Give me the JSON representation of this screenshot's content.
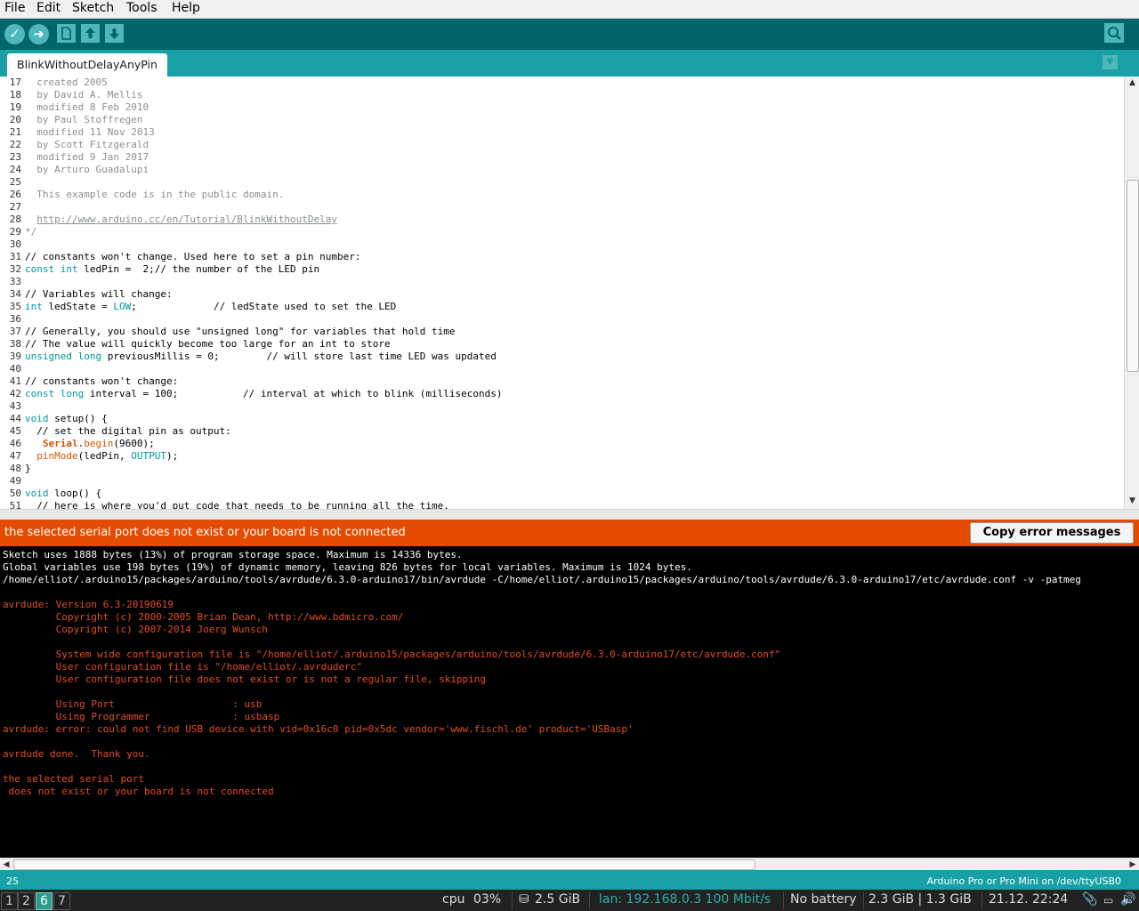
{
  "menubar": {
    "items": [
      "File",
      "Edit",
      "Sketch",
      "Tools",
      "Help"
    ]
  },
  "toolbar": {
    "verify_icon": "check-icon",
    "upload_icon": "arrow-right-icon",
    "new_icon": "new-document-icon",
    "open_icon": "arrow-up-icon",
    "save_icon": "arrow-down-icon",
    "serial_monitor_icon": "magnifier-icon"
  },
  "tab": {
    "label": "BlinkWithoutDelayAnyPin"
  },
  "editor": {
    "lines": [
      {
        "n": "17",
        "t": "  created 2005"
      },
      {
        "n": "18",
        "t": "  by David A. Mellis"
      },
      {
        "n": "19",
        "t": "  modified 8 Feb 2010"
      },
      {
        "n": "20",
        "t": "  by Paul Stoffregen"
      },
      {
        "n": "21",
        "t": "  modified 11 Nov 2013"
      },
      {
        "n": "22",
        "t": "  by Scott Fitzgerald"
      },
      {
        "n": "23",
        "t": "  modified 9 Jan 2017"
      },
      {
        "n": "24",
        "t": "  by Arturo Guadalupi"
      },
      {
        "n": "25",
        "t": ""
      },
      {
        "n": "26",
        "t": "  This example code is in the public domain."
      },
      {
        "n": "27",
        "t": ""
      },
      {
        "n": "28",
        "t": "  http://www.arduino.cc/en/Tutorial/BlinkWithoutDelay"
      },
      {
        "n": "29",
        "t": "*/"
      },
      {
        "n": "30",
        "t": ""
      },
      {
        "n": "31",
        "t": "// constants won't change. Used here to set a pin number:"
      },
      {
        "n": "32",
        "t": "const int ledPin =  2;// the number of the LED pin"
      },
      {
        "n": "33",
        "t": ""
      },
      {
        "n": "34",
        "t": "// Variables will change:"
      },
      {
        "n": "35",
        "t": "int ledState = LOW;             // ledState used to set the LED"
      },
      {
        "n": "36",
        "t": ""
      },
      {
        "n": "37",
        "t": "// Generally, you should use \"unsigned long\" for variables that hold time"
      },
      {
        "n": "38",
        "t": "// The value will quickly become too large for an int to store"
      },
      {
        "n": "39",
        "t": "unsigned long previousMillis = 0;        // will store last time LED was updated"
      },
      {
        "n": "40",
        "t": ""
      },
      {
        "n": "41",
        "t": "// constants won't change:"
      },
      {
        "n": "42",
        "t": "const long interval = 100;           // interval at which to blink (milliseconds)"
      },
      {
        "n": "43",
        "t": ""
      },
      {
        "n": "44",
        "t": "void setup() {"
      },
      {
        "n": "45",
        "t": "  // set the digital pin as output:"
      },
      {
        "n": "46",
        "t": "   Serial.begin(9600);"
      },
      {
        "n": "47",
        "t": "  pinMode(ledPin, OUTPUT);"
      },
      {
        "n": "48",
        "t": "}"
      },
      {
        "n": "49",
        "t": ""
      },
      {
        "n": "50",
        "t": "void loop() {"
      },
      {
        "n": "51",
        "t": "  // here is where you'd put code that needs to be running all the time."
      }
    ]
  },
  "error_bar": {
    "message": "the selected serial port  does not exist or your board is not connected",
    "copy_button": "Copy error messages"
  },
  "console": {
    "lines": [
      {
        "t": "Sketch uses 1888 bytes (13%) of program storage space. Maximum is 14336 bytes.",
        "c": "white"
      },
      {
        "t": "Global variables use 198 bytes (19%) of dynamic memory, leaving 826 bytes for local variables. Maximum is 1024 bytes.",
        "c": "white"
      },
      {
        "t": "/home/elliot/.arduino15/packages/arduino/tools/avrdude/6.3.0-arduino17/bin/avrdude -C/home/elliot/.arduino15/packages/arduino/tools/avrdude/6.3.0-arduino17/etc/avrdude.conf -v -patmeg",
        "c": "white"
      },
      {
        "t": "",
        "c": "red"
      },
      {
        "t": "avrdude: Version 6.3-20190619",
        "c": "red"
      },
      {
        "t": "         Copyright (c) 2000-2005 Brian Dean, http://www.bdmicro.com/",
        "c": "red"
      },
      {
        "t": "         Copyright (c) 2007-2014 Joerg Wunsch",
        "c": "red"
      },
      {
        "t": "",
        "c": "red"
      },
      {
        "t": "         System wide configuration file is \"/home/elliot/.arduino15/packages/arduino/tools/avrdude/6.3.0-arduino17/etc/avrdude.conf\"",
        "c": "red"
      },
      {
        "t": "         User configuration file is \"/home/elliot/.avrduderc\"",
        "c": "red"
      },
      {
        "t": "         User configuration file does not exist or is not a regular file, skipping",
        "c": "red"
      },
      {
        "t": "",
        "c": "red"
      },
      {
        "t": "         Using Port                    : usb",
        "c": "red"
      },
      {
        "t": "         Using Programmer              : usbasp",
        "c": "red"
      },
      {
        "t": "avrdude: error: could not find USB device with vid=0x16c0 pid=0x5dc vendor='www.fischl.de' product='USBasp'",
        "c": "red"
      },
      {
        "t": "",
        "c": "red"
      },
      {
        "t": "avrdude done.  Thank you.",
        "c": "red"
      },
      {
        "t": "",
        "c": "red"
      },
      {
        "t": "the selected serial port",
        "c": "red"
      },
      {
        "t": " does not exist or your board is not connected",
        "c": "red"
      }
    ]
  },
  "statusbar": {
    "line_number": "25",
    "board": "Arduino Pro or Pro Mini on /dev/ttyUSB0"
  },
  "taskbar": {
    "workspaces": [
      "1",
      "2",
      "6",
      "7"
    ],
    "active_workspace": "6",
    "cpu_label": "cpu",
    "cpu_value": "03%",
    "disk": "2.5 GiB",
    "lan": "lan: 192.168.0.3 100 Mbit/s",
    "battery": "No battery",
    "memory": "2.3 GiB | 1.3 GiB",
    "datetime": "21.12. 22:24",
    "colors": {
      "lan": "#2ab0a8",
      "active_ws": "#2e9c8c"
    }
  }
}
